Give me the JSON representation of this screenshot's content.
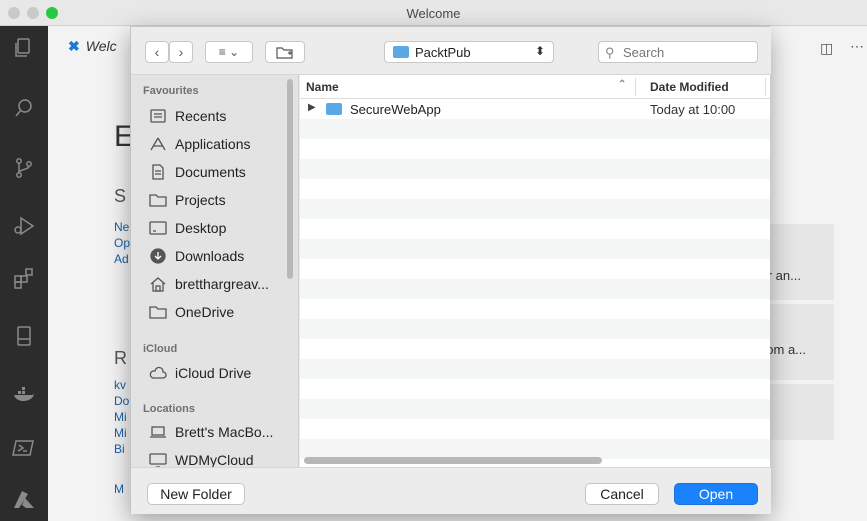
{
  "window": {
    "title": "Welcome"
  },
  "vscode": {
    "tab_label": "Welc",
    "welcome_heading": "E",
    "start_heading": "S",
    "recent_heading": "R",
    "start_links": [
      "Ne",
      "Op",
      "Ad"
    ],
    "recent_links": [
      "kv",
      "Do",
      "Mi",
      "Mi",
      "Bi"
    ],
    "extra_link": "M",
    "cards": [
      "ker an...",
      "Atom a..."
    ],
    "activity_icons": [
      "explorer-icon",
      "search-icon",
      "source-control-icon",
      "run-debug-icon",
      "extensions-icon",
      "remote-explorer-icon",
      "docker-icon",
      "powershell-icon",
      "azure-icon"
    ]
  },
  "dialog": {
    "location": "PacktPub",
    "search_placeholder": "Search",
    "sidebar": {
      "favourites_heading": "Favourites",
      "favourites": [
        {
          "label": "Recents",
          "icon": "recents-icon"
        },
        {
          "label": "Applications",
          "icon": "applications-icon"
        },
        {
          "label": "Documents",
          "icon": "documents-icon"
        },
        {
          "label": "Projects",
          "icon": "folder-icon"
        },
        {
          "label": "Desktop",
          "icon": "desktop-icon"
        },
        {
          "label": "Downloads",
          "icon": "downloads-icon"
        },
        {
          "label": "bretthargreav...",
          "icon": "home-icon"
        },
        {
          "label": "OneDrive",
          "icon": "folder-icon"
        }
      ],
      "icloud_heading": "iCloud",
      "icloud": [
        {
          "label": "iCloud Drive",
          "icon": "cloud-icon"
        }
      ],
      "locations_heading": "Locations",
      "locations": [
        {
          "label": "Brett's MacBo...",
          "icon": "laptop-icon"
        },
        {
          "label": "WDMyCloud",
          "icon": "display-icon"
        }
      ]
    },
    "columns": {
      "name": "Name",
      "date_modified": "Date Modified"
    },
    "files": [
      {
        "name": "SecureWebApp",
        "date": "Today at 10:00",
        "type": "folder"
      }
    ],
    "buttons": {
      "new_folder": "New Folder",
      "cancel": "Cancel",
      "open": "Open"
    },
    "colors": {
      "accent": "#1a82fb",
      "folder": "#5aa9e6"
    }
  }
}
